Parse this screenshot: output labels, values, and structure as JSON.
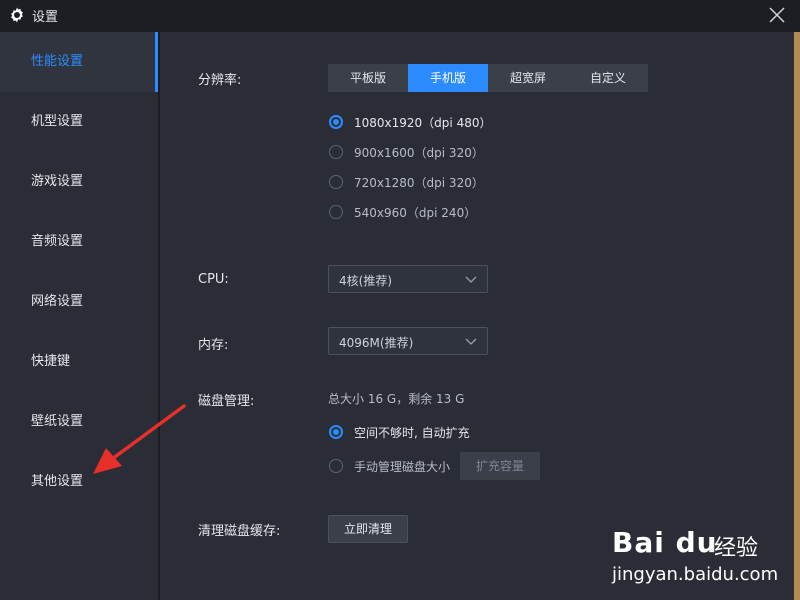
{
  "window": {
    "title": "设置"
  },
  "sidebar": {
    "items": [
      {
        "label": "性能设置"
      },
      {
        "label": "机型设置"
      },
      {
        "label": "游戏设置"
      },
      {
        "label": "音频设置"
      },
      {
        "label": "网络设置"
      },
      {
        "label": "快捷键"
      },
      {
        "label": "壁纸设置"
      },
      {
        "label": "其他设置"
      }
    ],
    "active": "性能设置"
  },
  "resolution": {
    "label": "分辨率:",
    "tabs": [
      "平板版",
      "手机版",
      "超宽屏",
      "自定义"
    ],
    "active_tab": "手机版",
    "options": [
      "1080x1920（dpi 480）",
      "900x1600（dpi 320）",
      "720x1280（dpi 320）",
      "540x960（dpi 240）"
    ],
    "selected": "1080x1920（dpi 480）"
  },
  "cpu": {
    "label": "CPU:",
    "value": "4核(推荐)"
  },
  "memory": {
    "label": "内存:",
    "value": "4096M(推荐)"
  },
  "disk": {
    "label": "磁盘管理:",
    "info": "总大小 16 G，剩余 13 G",
    "options": [
      "空间不够时, 自动扩充",
      "手动管理磁盘大小"
    ],
    "selected": "空间不够时, 自动扩充",
    "expand_button": "扩充容量"
  },
  "cache": {
    "label": "清理磁盘缓存:",
    "button": "立即清理"
  },
  "watermark": {
    "brand": "Bai du",
    "name": "经验",
    "url": "jingyan.baidu.com"
  },
  "colors": {
    "accent": "#2c8cff",
    "background": "#2a2d36",
    "annotation_arrow": "#e8302a"
  }
}
